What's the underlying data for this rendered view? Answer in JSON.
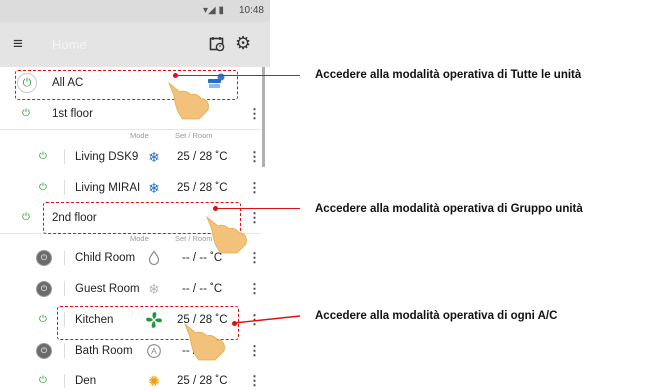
{
  "status_bar": {
    "time": "10:48",
    "signal_icon": "signal-wifi-battery-icon"
  },
  "app_bar": {
    "title": "Home",
    "menu_icon": "hamburger-menu-icon",
    "schedule_icon": "calendar-clock-icon",
    "settings_icon": "gear-icon"
  },
  "column_headers": {
    "mode": "Mode",
    "set_room": "Set / Room"
  },
  "groups": [
    {
      "id": "all",
      "name": "All AC",
      "power": "on",
      "status_icon": "group-ac-icon"
    },
    {
      "id": "first",
      "name": "1st floor",
      "power": "on"
    },
    {
      "id": "second",
      "name": "2nd floor",
      "power": "on"
    }
  ],
  "units": [
    {
      "name": "Living DSK9",
      "power": "on",
      "mode_icon": "snowflake-cool-icon",
      "temp": "25 / 28 ˚C"
    },
    {
      "name": "Living MIRAI",
      "power": "on",
      "mode_icon": "snowflake-cool-icon",
      "temp": "25 / 28 ˚C"
    },
    {
      "name": "Child Room",
      "power": "off",
      "mode_icon": "droplet-dry-icon",
      "temp": "-- / --  ˚C"
    },
    {
      "name": "Guest Room",
      "power": "off",
      "mode_icon": "snowflake-cool-icon",
      "temp": "-- / --  ˚C"
    },
    {
      "name": "Kitchen",
      "power": "on",
      "mode_icon": "fan-icon",
      "temp": "25 / 28 ˚C"
    },
    {
      "name": "Bath Room",
      "power": "off",
      "mode_icon": "auto-mode-icon",
      "temp": "-- / --  ˚C"
    },
    {
      "name": "Den",
      "power": "on",
      "mode_icon": "sun-heat-icon",
      "temp": "25 / 28 ˚C"
    }
  ],
  "callouts": [
    "Accedere alla modalità operativa di Tutte le unità",
    "Accedere alla modalità operativa di Gruppo unità",
    "Accedere alla modalità operativa di ogni A/C"
  ],
  "colors": {
    "highlight": "#e01010",
    "power_on": "#2a9d2a",
    "cool_mode": "#1f6fd0",
    "fan_mode": "#1a9a3a",
    "heat_mode": "#f59a00",
    "hand": "#f2c27a"
  }
}
